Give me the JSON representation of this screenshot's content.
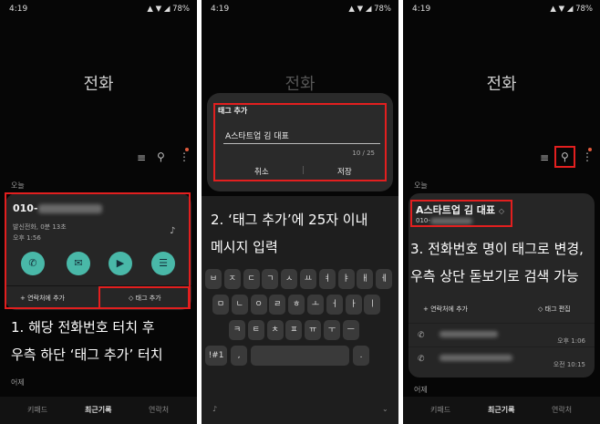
{
  "status": {
    "time": "4:19",
    "battery": "78%"
  },
  "app_title": "전화",
  "section_today": "오늘",
  "section_yesterday": "어제",
  "p1": {
    "number_prefix": "010-",
    "detail": "발신전화, 0분 13초",
    "time": "오후 1:56",
    "add_contact": "+ 연락처에 추가",
    "add_tag": "태그 추가",
    "caption1": "1.   해당 전화번호 터치 후",
    "caption2": "우측 하단 ‘태그 추가’ 터치"
  },
  "p2": {
    "dialog_title": "태그 추가",
    "input_value": "A스타트업 김 대표",
    "counter": "10 / 25",
    "cancel": "취소",
    "save": "저장",
    "caption1": "2. ‘태그 추가’에 25자 이내",
    "caption2": "메시지 입력",
    "keys_row1": [
      "ㅂ",
      "ㅈ",
      "ㄷ",
      "ㄱ",
      "ㅅ",
      "ㅛ",
      "ㅕ",
      "ㅑ",
      "ㅐ",
      "ㅔ"
    ],
    "keys_row2": [
      "ㅁ",
      "ㄴ",
      "ㅇ",
      "ㄹ",
      "ㅎ",
      "ㅗ",
      "ㅓ",
      "ㅏ",
      "ㅣ"
    ],
    "keys_row3": [
      "ㅋ",
      "ㅌ",
      "ㅊ",
      "ㅍ",
      "ㅠ",
      "ㅜ",
      "ㅡ"
    ],
    "key_sym": "!#1",
    "key_comma": ",",
    "key_dot": "."
  },
  "p3": {
    "tag_name": "A스타트업 김 대표",
    "number_prefix": "010-",
    "add_contact": "+ 연락처에 추가",
    "edit_tag": "태그 편집",
    "caption1": "3. 전화번호 명이 태그로 변경,",
    "caption2": "우측 상단 돋보기로 검색 가능",
    "row_times": [
      "오후 1:06",
      "오전 10:15"
    ]
  },
  "nav": {
    "keypad": "키패드",
    "recent": "최근기록",
    "contacts": "연락처"
  },
  "colors": {
    "highlight": "#e21f1f",
    "accent": "#49b8a8"
  },
  "icons": [
    "search-icon",
    "filter-icon",
    "more-icon",
    "call-icon",
    "message-icon",
    "video-icon",
    "details-icon",
    "tag-icon",
    "mic-icon",
    "phone-icon"
  ]
}
